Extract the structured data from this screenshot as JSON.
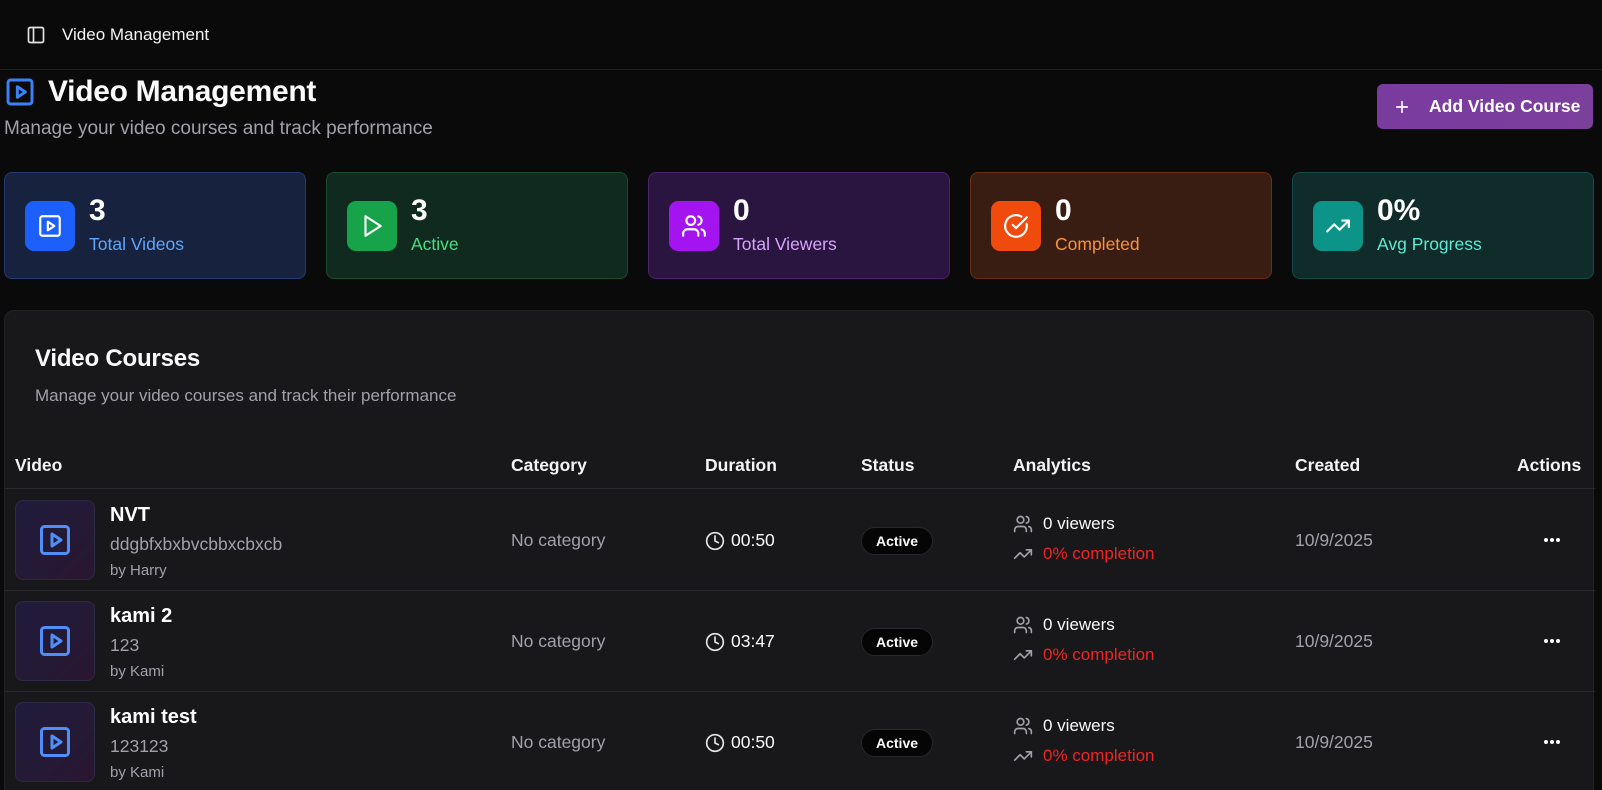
{
  "topbar": {
    "breadcrumb": "Video Management"
  },
  "header": {
    "title": "Video Management",
    "subtitle": "Manage your video courses and track performance",
    "add_button": "Add Video Course"
  },
  "stats": [
    {
      "value": "3",
      "label": "Total Videos",
      "icon": "play-square-icon",
      "accent": "#1d5ffb"
    },
    {
      "value": "3",
      "label": "Active",
      "icon": "play-icon",
      "accent": "#16a34a"
    },
    {
      "value": "0",
      "label": "Total Viewers",
      "icon": "users-icon",
      "accent": "#a314f0"
    },
    {
      "value": "0",
      "label": "Completed",
      "icon": "check-circle-icon",
      "accent": "#f04a0c"
    },
    {
      "value": "0%",
      "label": "Avg Progress",
      "icon": "trending-up-icon",
      "accent": "#0d9488"
    }
  ],
  "panel": {
    "title": "Video Courses",
    "subtitle": "Manage your video courses and track their performance"
  },
  "table": {
    "columns": [
      "Video",
      "Category",
      "Duration",
      "Status",
      "Analytics",
      "Created",
      "Actions"
    ],
    "rows": [
      {
        "title": "NVT",
        "description": "ddgbfxbxbvcbbxcbxcb",
        "author": "by Harry",
        "category": "No category",
        "duration": "00:50",
        "status": "Active",
        "viewers": "0 viewers",
        "completion": "0% completion",
        "created": "10/9/2025"
      },
      {
        "title": "kami 2",
        "description": "123",
        "author": "by Kami",
        "category": "No category",
        "duration": "03:47",
        "status": "Active",
        "viewers": "0 viewers",
        "completion": "0% completion",
        "created": "10/9/2025"
      },
      {
        "title": "kami test",
        "description": "123123",
        "author": "by Kami",
        "category": "No category",
        "duration": "00:50",
        "status": "Active",
        "viewers": "0 viewers",
        "completion": "0% completion",
        "created": "10/9/2025"
      }
    ]
  },
  "colors": {
    "background": "#0a0a0a",
    "panel": "#18181b",
    "primary_button": "#7b3d9f",
    "completion_red": "#ef2424"
  }
}
